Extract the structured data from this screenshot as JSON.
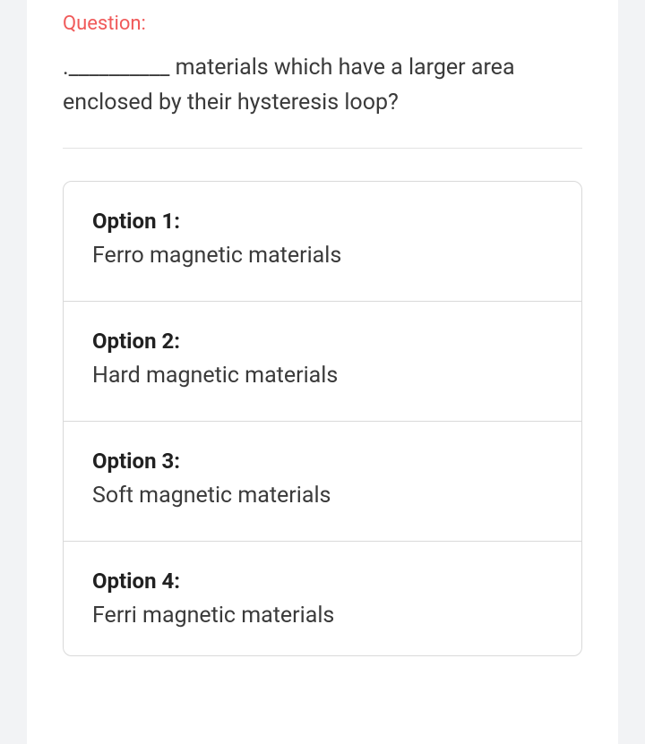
{
  "question": {
    "label": "Question:",
    "text": ".__________ materials which have a larger area enclosed by  their hysteresis loop?"
  },
  "options": [
    {
      "label": "Option 1:",
      "text": "Ferro magnetic materials"
    },
    {
      "label": "Option 2:",
      "text": "Hard magnetic materials"
    },
    {
      "label": "Option 3:",
      "text": "Soft magnetic materials"
    },
    {
      "label": "Option 4:",
      "text": "Ferri magnetic  materials"
    }
  ]
}
